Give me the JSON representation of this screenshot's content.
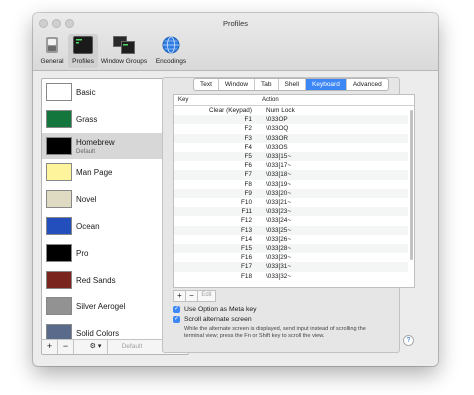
{
  "window": {
    "title": "Profiles"
  },
  "toolbar": {
    "items": [
      {
        "label": "General"
      },
      {
        "label": "Profiles"
      },
      {
        "label": "Window Groups"
      },
      {
        "label": "Encodings"
      }
    ]
  },
  "profiles": {
    "items": [
      {
        "name": "Basic",
        "thumb_bg": "#ffffff"
      },
      {
        "name": "Grass",
        "thumb_bg": "#13773d"
      },
      {
        "name": "Homebrew",
        "subtitle": "Default",
        "thumb_bg": "#000000"
      },
      {
        "name": "Man Page",
        "thumb_bg": "#fef49c"
      },
      {
        "name": "Novel",
        "thumb_bg": "#dfdbc3"
      },
      {
        "name": "Ocean",
        "thumb_bg": "#224fbc"
      },
      {
        "name": "Pro",
        "thumb_bg": "#000000"
      },
      {
        "name": "Red Sands",
        "thumb_bg": "#7a251e"
      },
      {
        "name": "Silver Aerogel",
        "thumb_bg": "#929292"
      },
      {
        "name": "Solid Colors",
        "thumb_bg": "#5a6a8a"
      }
    ],
    "footer": {
      "add": "+",
      "remove": "−",
      "gear": "⚙ ▾",
      "default_label": "Default"
    }
  },
  "tabs": [
    "Text",
    "Window",
    "Tab",
    "Shell",
    "Keyboard",
    "Advanced"
  ],
  "active_tab": "Keyboard",
  "keyboard": {
    "col_key": "Key",
    "col_action": "Action",
    "rows": [
      {
        "key": "Clear (Keypad)",
        "action": "Num Lock"
      },
      {
        "key": "F1",
        "action": "\\033OP"
      },
      {
        "key": "F2",
        "action": "\\033OQ"
      },
      {
        "key": "F3",
        "action": "\\033OR"
      },
      {
        "key": "F4",
        "action": "\\033OS"
      },
      {
        "key": "F5",
        "action": "\\033[15~"
      },
      {
        "key": "F6",
        "action": "\\033[17~"
      },
      {
        "key": "F7",
        "action": "\\033[18~"
      },
      {
        "key": "F8",
        "action": "\\033[19~"
      },
      {
        "key": "F9",
        "action": "\\033[20~"
      },
      {
        "key": "F10",
        "action": "\\033[21~"
      },
      {
        "key": "F11",
        "action": "\\033[23~"
      },
      {
        "key": "F12",
        "action": "\\033[24~"
      },
      {
        "key": "F13",
        "action": "\\033[25~"
      },
      {
        "key": "F14",
        "action": "\\033[26~"
      },
      {
        "key": "F15",
        "action": "\\033[28~"
      },
      {
        "key": "F16",
        "action": "\\033[29~"
      },
      {
        "key": "F17",
        "action": "\\033[31~"
      },
      {
        "key": "F18",
        "action": "\\033[32~"
      }
    ],
    "buttons": {
      "add": "+",
      "remove": "−",
      "edit": "Edit"
    },
    "option_meta_label": "Use Option as Meta key",
    "scroll_alt_label": "Scroll alternate screen",
    "note": "While the alternate screen is displayed, send input instead of scrolling the terminal view; press the Fn or Shift key to scroll the view.",
    "help": "?"
  },
  "colors": {
    "accent": "#3c86f6"
  }
}
